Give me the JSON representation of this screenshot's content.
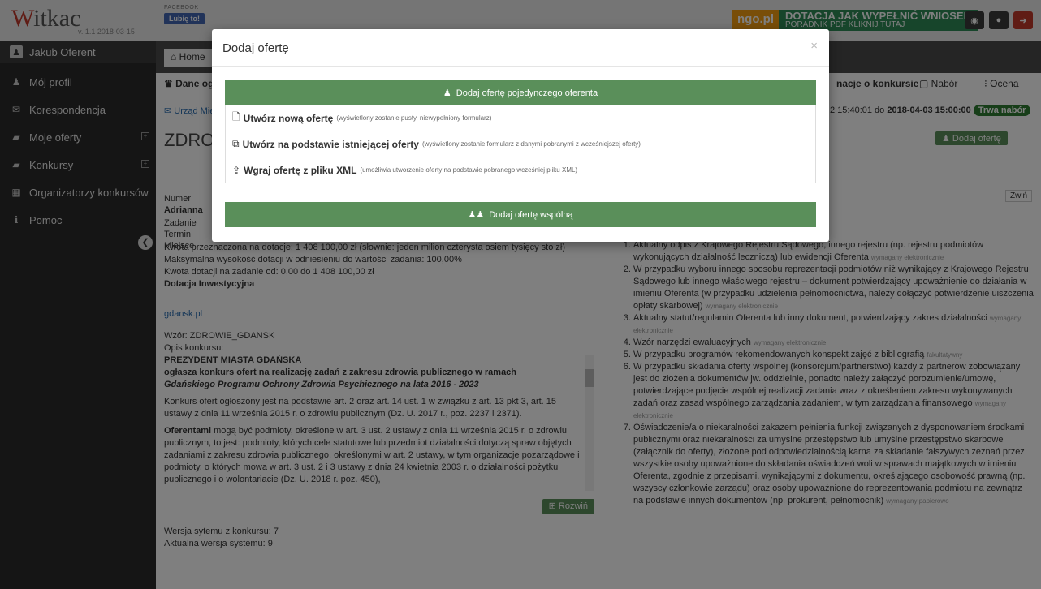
{
  "brand": {
    "logo_w": "W",
    "logo_rest": "itkac",
    "version": "v. 1.1 2018-03-15"
  },
  "user": {
    "name": "Jakub Oferent"
  },
  "sidebar": {
    "items": [
      {
        "label": "Mój profil",
        "icon": "user-icon"
      },
      {
        "label": "Korespondencja",
        "icon": "envelope-icon"
      },
      {
        "label": "Moje oferty",
        "icon": "book-icon"
      },
      {
        "label": "Konkursy",
        "icon": "book-icon"
      },
      {
        "label": "Organizatorzy konkursów",
        "icon": "building-icon"
      },
      {
        "label": "Pomoc",
        "icon": "info-icon"
      }
    ]
  },
  "topbar": {
    "facebook_label": "FACEBOOK",
    "fb_button": "Lubię to!",
    "ngo_logo": "ngo.pl",
    "ngo_line1": "DOTACJA",
    "ngo_line1b": "JAK WYPEŁNIĆ WNIOSEK",
    "ngo_line2": "PORADNIK PDF KLIKNIJ TUTAJ"
  },
  "tabbar": {
    "home": "Home"
  },
  "content": {
    "tab_active": "Dane ogólne",
    "tab_info": "nacje o konkursie",
    "tab_nabor": "Nabór",
    "tab_ocena": "Ocena",
    "urzad": "Urząd Miejski",
    "dates_text": "2 15:40:01 do",
    "date_end": "2018-04-03 15:00:00",
    "status_pill": "Trwa nabór",
    "title": "ZDRO",
    "add_offer_btn": "Dodaj ofertę",
    "collapse_btn": "Zwiń",
    "numer_label": "Numer",
    "numer_value": "Adrianna",
    "zadanie": "Zadanie",
    "termin": "Termin",
    "miejsce": "Miejsce",
    "kwota_line": "Kwota przeznaczona na dotacje: 1 408 100,00 zł (słownie: jeden milion czterysta osiem tysięcy sto zł)",
    "max_line": "Maksymalna wysokość dotacji w odniesieniu do wartości zadania: 100,00%",
    "range_line": "Kwota dotacji na zadanie od: 0,00 do 1 408 100,00 zł",
    "dotacja": "Dotacja Inwestycyjna",
    "link": "gdansk.pl",
    "wzor": "Wzór: ZDROWIE_GDANSK",
    "opis": "Opis konkursu:",
    "president": "PREZYDENT MIASTA GDAŃSKA",
    "oglasza": "ogłasza konkurs ofert na realizację zadań z zakresu zdrowia publicznego w ramach",
    "program": "Gdańskiego Programu Ochrony Zdrowia Psychicznego na lata 2016 - 2023",
    "para1": "Konkurs ofert ogłoszony jest na podstawie art. 2 oraz art. 14 ust. 1 w związku z art. 13 pkt 3, art. 15 ustawy z dnia 11 września 2015 r. o zdrowiu publicznym (Dz. U. 2017 r., poz. 2237 i 2371).",
    "para2_bold": "Oferentami",
    "para2": " mogą być podmioty, określone w art. 3 ust. 2 ustawy z dnia 11 września 2015 r. o zdrowiu publicznym, to jest: podmioty, których cele statutowe lub przedmiot działalności dotyczą spraw objętych zadaniami z zakresu zdrowia publicznego, określonymi w art. 2 ustawy, w tym organizacje pozarządowe i podmioty, o których mowa w art. 3 ust. 2 i 3 ustawy z dnia 24 kwietnia 2003 r. o działalności pożytku publicznego i o wolontariacie (Dz. U. 2018 r. poz. 450),",
    "rozwin": "Rozwiń",
    "wersja1": "Wersja sytemu z konkursu: 7",
    "wersja2": "Aktualna wersja systemu: 9",
    "docs": [
      {
        "t": "Aktualny odpis z Krajowego Rejestru Sądowego, innego rejestru (np. rejestru podmiotów wykonujących działalność leczniczą) lub ewidencji Oferenta",
        "n": "wymagany elektronicznie"
      },
      {
        "t": "W przypadku wyboru innego sposobu reprezentacji podmiotów niż wynikający z Krajowego Rejestru Sądowego lub innego właściwego rejestru – dokument potwierdzający upoważnienie do działania w imieniu Oferenta (w przypadku udzielenia pełnomocnictwa, należy dołączyć potwierdzenie uiszczenia opłaty skarbowej)",
        "n": "wymagany elektronicznie"
      },
      {
        "t": "Aktualny statut/regulamin Oferenta lub inny dokument, potwierdzający zakres działalności",
        "n": "wymagany elektronicznie"
      },
      {
        "t": "Wzór narzędzi ewaluacyjnych",
        "n": "wymagany elektronicznie"
      },
      {
        "t": "W przypadku programów rekomendowanych konspekt zajęć z bibliografią",
        "n": "fakultatywny"
      },
      {
        "t": "W przypadku składania oferty wspólnej (konsorcjum/partnerstwo) każdy z partnerów zobowiązany jest do złożenia dokumentów jw. oddzielnie, ponadto należy załączyć porozumienie/umowę, potwierdzające podjęcie wspólnej realizacji zadania wraz z określeniem zakresu wykonywanych zadań oraz zasad wspólnego zarządzania zadaniem, w tym zarządzania finansowego",
        "n": "wymagany elektronicznie"
      },
      {
        "t": "Oświadczenie/a o niekaralności zakazem pełnienia funkcji związanych z dysponowaniem środkami publicznymi oraz niekaralności za umyślne przestępstwo lub umyślne przestępstwo skarbowe (załącznik do oferty), złożone pod odpowiedzialnością karna za składanie fałszywych zeznań przez wszystkie osoby upoważnione do składania oświadczeń woli w sprawach majątkowych w imieniu Oferenta, zgodnie z przepisami, wynikającymi z dokumentu, określającego osobowość prawną (np. wszyscy członkowie zarządu) oraz osoby upoważnione do reprezentowania podmiotu na zewnątrz na podstawie innych dokumentów (np. prokurent, pełnomocnik)",
        "n": "wymagany papierowo"
      }
    ]
  },
  "modal": {
    "title": "Dodaj ofertę",
    "close": "×",
    "single_header": "Dodaj ofertę pojedynczego oferenta",
    "options": [
      {
        "label": "Utwórz nową ofertę",
        "hint": "(wyświetlony zostanie pusty, niewypełniony formularz)"
      },
      {
        "label": "Utwórz na podstawie istniejącej oferty",
        "hint": "(wyświetlony zostanie formularz z danymi pobranymi z wcześniejszej oferty)"
      },
      {
        "label": "Wgraj ofertę z pliku XML",
        "hint": "(umożliwia utworzenie oferty na podstawie pobranego wcześniej pliku XML)"
      }
    ],
    "joint": "Dodaj ofertę wspólną"
  }
}
